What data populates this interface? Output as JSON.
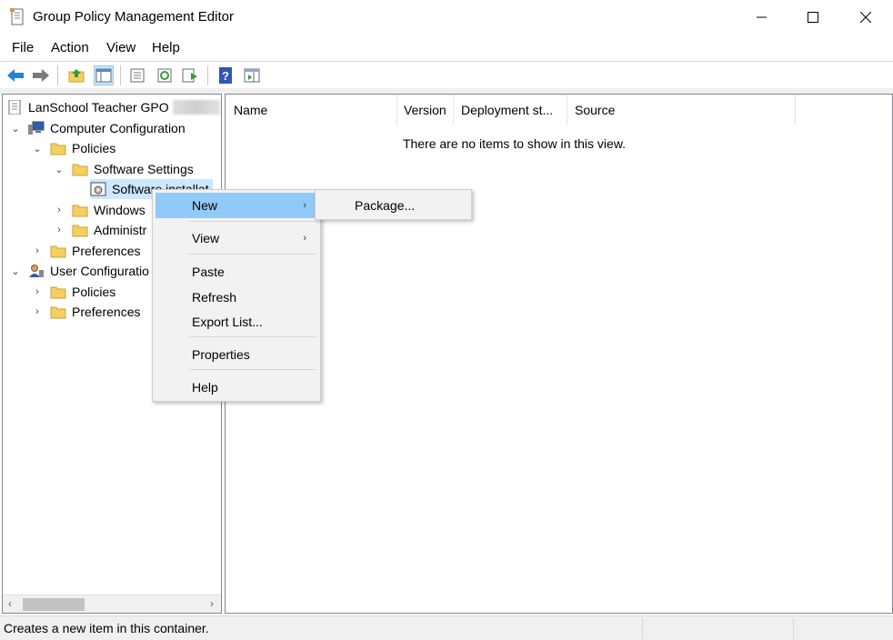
{
  "window": {
    "title": "Group Policy Management Editor"
  },
  "menubar": {
    "items": [
      "File",
      "Action",
      "View",
      "Help"
    ]
  },
  "toolbar": {
    "icons": [
      "back-arrow-icon",
      "forward-arrow-icon",
      "up-folder-icon",
      "show-hide-tree-icon",
      "properties-icon",
      "refresh-icon",
      "export-list-icon",
      "help-icon",
      "show-hide-action-pane-icon"
    ]
  },
  "tree": {
    "root": "LanSchool Teacher GPO",
    "computer_configuration": "Computer Configuration",
    "cc_policies": "Policies",
    "software_settings": "Software Settings",
    "software_installation": "Software installat",
    "windows_settings": "Windows",
    "administrative_templates": "Administr",
    "cc_preferences": "Preferences",
    "user_configuration": "User Configuratio",
    "uc_policies": "Policies",
    "uc_preferences": "Preferences"
  },
  "list": {
    "columns": [
      "Name",
      "Version",
      "Deployment st...",
      "Source"
    ],
    "empty_message": "There are no items to show in this view."
  },
  "context_menu": {
    "new": "New",
    "view": "View",
    "paste": "Paste",
    "refresh": "Refresh",
    "export_list": "Export List...",
    "properties": "Properties",
    "help": "Help"
  },
  "submenu": {
    "package": "Package..."
  },
  "status": {
    "text": "Creates a new item in this container."
  },
  "colors": {
    "highlight": "#91c9f7",
    "selection": "#cce8ff",
    "folder": "#f5cf5f",
    "back_arrow": "#2b7fd4"
  }
}
